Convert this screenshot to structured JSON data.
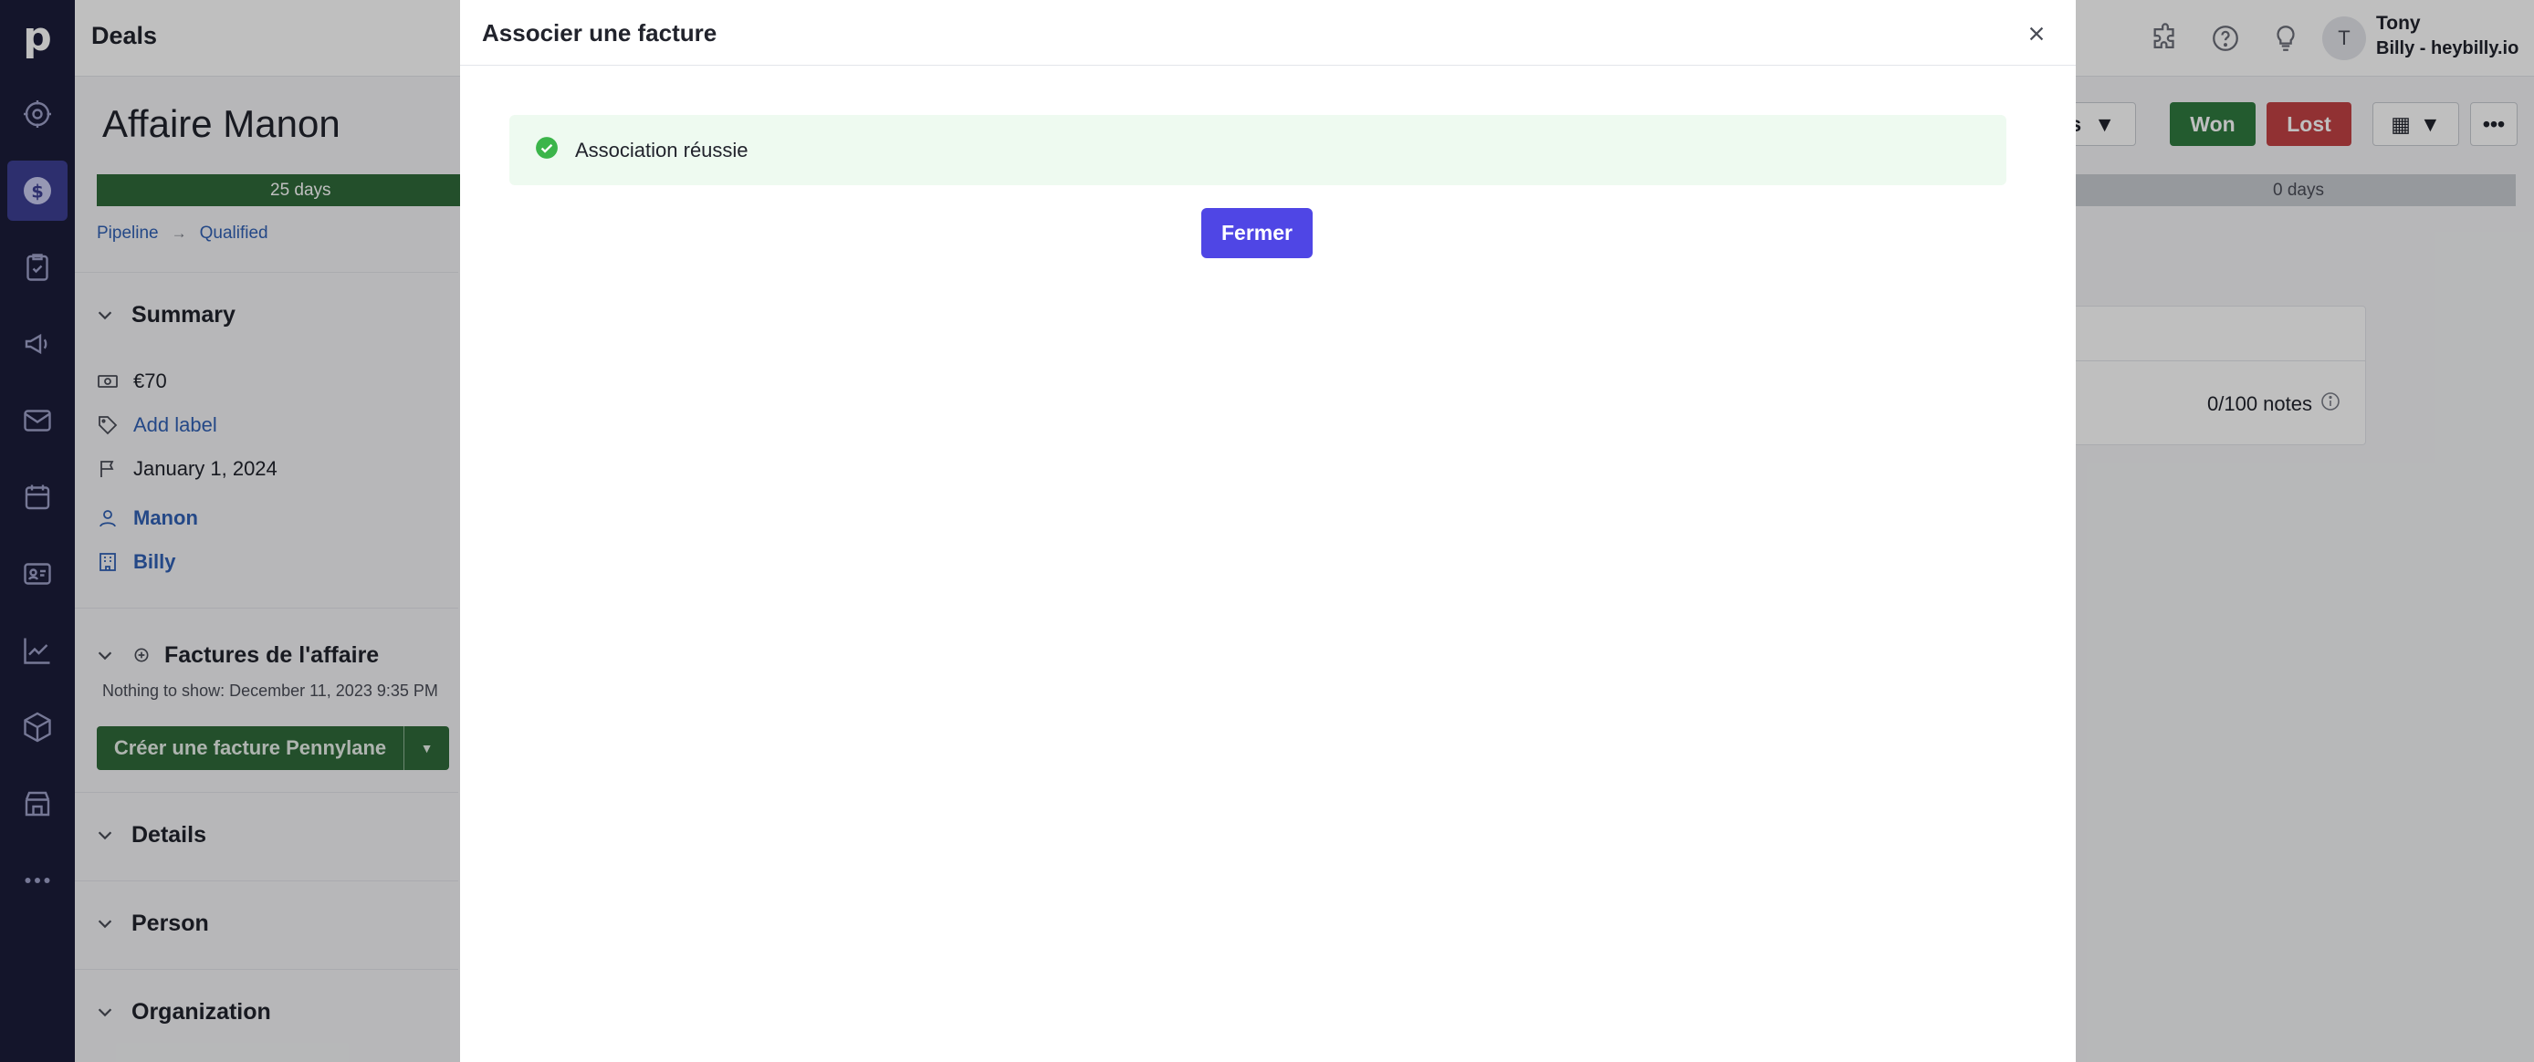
{
  "app": {
    "section_title": "Deals",
    "logo_letter": "p"
  },
  "nav": {
    "items": [
      {
        "name": "leads-icon"
      },
      {
        "name": "deals-icon",
        "active": true
      },
      {
        "name": "projects-icon"
      },
      {
        "name": "campaigns-icon"
      },
      {
        "name": "mail-icon"
      },
      {
        "name": "activities-icon"
      },
      {
        "name": "contacts-icon"
      },
      {
        "name": "insights-icon"
      },
      {
        "name": "products-icon"
      },
      {
        "name": "marketplace-icon"
      },
      {
        "name": "more-icon"
      }
    ]
  },
  "user": {
    "initial": "T",
    "name": "Tony",
    "company": "Billy - heybilly.io"
  },
  "deal": {
    "title": "Affaire Manon",
    "stage_days_active": "25 days",
    "stage_days_last": "0 days",
    "breadcrumb": {
      "pipeline": "Pipeline",
      "stage": "Qualified"
    },
    "owner_button_label": "rs",
    "won_label": "Won",
    "lost_label": "Lost"
  },
  "summary": {
    "title": "Summary",
    "value": "€70",
    "add_label": "Add label",
    "date": "January 1, 2024",
    "person": "Manon",
    "organization": "Billy"
  },
  "invoices": {
    "title": "Factures de l'affaire",
    "nothing": "Nothing to show: December 11, 2023 9:35 PM",
    "create_button": "Créer une facture Pennylane"
  },
  "sections": {
    "details": "Details",
    "person": "Person",
    "organization": "Organization"
  },
  "notes": {
    "count": "0/100 notes"
  },
  "modal": {
    "title": "Associer une facture",
    "success_message": "Association réussie",
    "close_button": "Fermer"
  },
  "colors": {
    "nav_bg": "#1b1d3a",
    "nav_active": "#3c3f93",
    "won": "#2f7a3f",
    "lost": "#c24245",
    "primary_button": "#4f46e5",
    "success_bg": "#eefaf0",
    "success_icon": "#3bb54a"
  }
}
